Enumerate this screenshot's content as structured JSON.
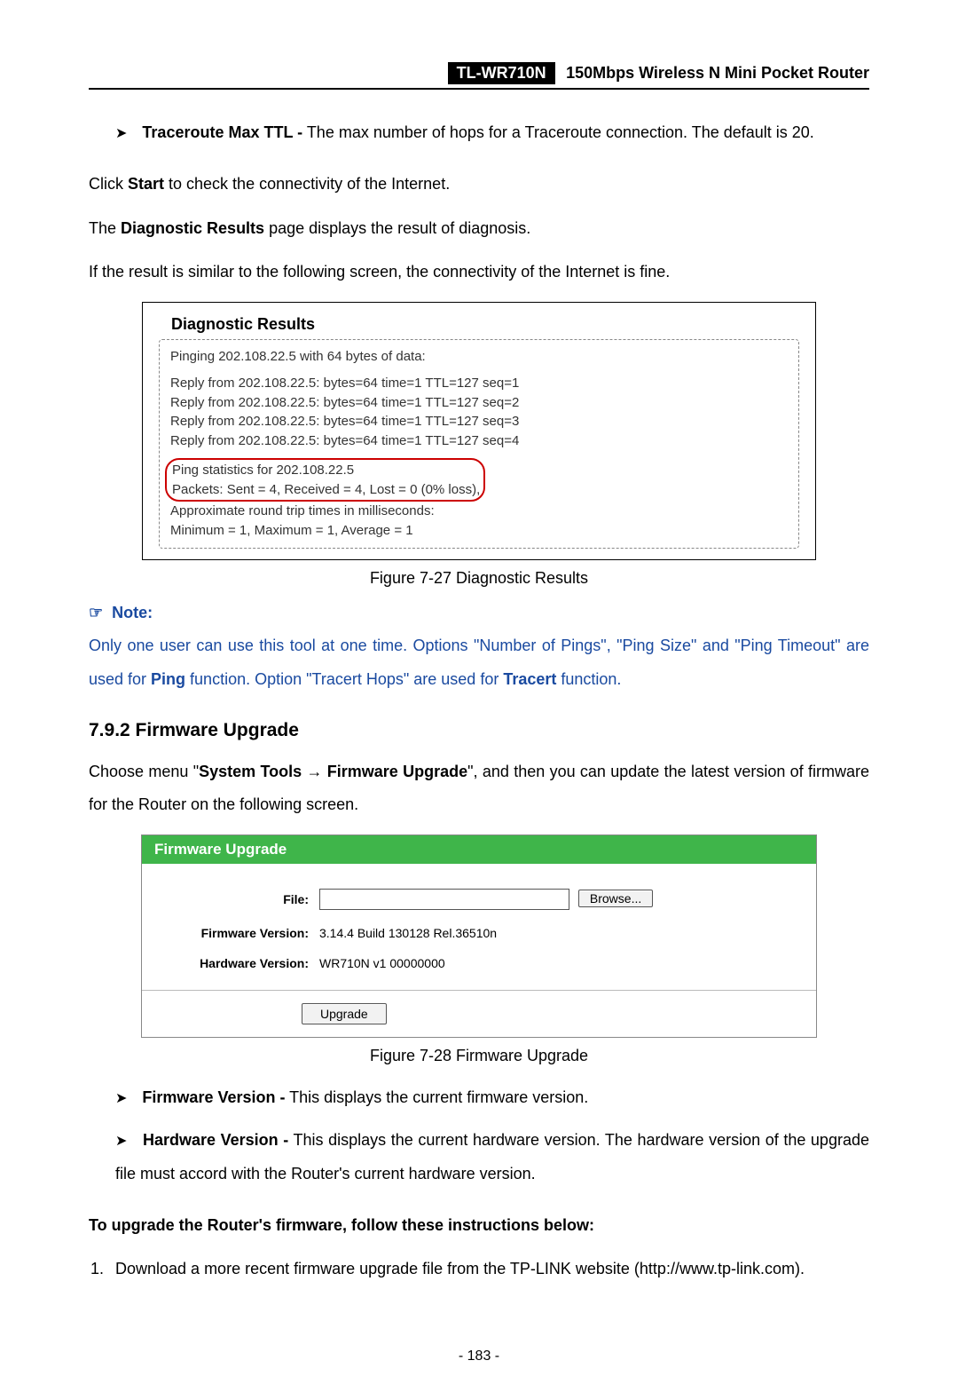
{
  "header": {
    "model": "TL-WR710N",
    "desc": "150Mbps Wireless N Mini Pocket Router"
  },
  "bullet1": {
    "term": "Traceroute Max TTL -",
    "rest": " The max number of hops for a Traceroute connection. The default is 20."
  },
  "p_click_pre": "Click ",
  "p_click_bold": "Start",
  "p_click_post": " to check the connectivity of the Internet.",
  "p_diag_pre": "The ",
  "p_diag_bold": "Diagnostic Results",
  "p_diag_post": " page displays the result of diagnosis.",
  "p_if": "If the result is similar to the following screen, the connectivity of the Internet is fine.",
  "diag": {
    "title": "Diagnostic Results",
    "ping_hdr": "Pinging 202.108.22.5 with 64 bytes of data:",
    "r1": "Reply from 202.108.22.5:  bytes=64  time=1  TTL=127  seq=1",
    "r2": "Reply from 202.108.22.5:  bytes=64  time=1  TTL=127  seq=2",
    "r3": "Reply from 202.108.22.5:  bytes=64  time=1  TTL=127  seq=3",
    "r4": "Reply from 202.108.22.5:  bytes=64  time=1  TTL=127  seq=4",
    "stat1": "Ping statistics for 202.108.22.5",
    "stat2": "  Packets: Sent = 4, Received = 4, Lost = 0 (0% loss),",
    "rtt1": "Approximate round trip times in milliseconds:",
    "rtt2": "  Minimum = 1, Maximum = 1, Average = 1"
  },
  "fig27": "Figure 7-27    Diagnostic Results",
  "note": {
    "label": "Note:",
    "body_pre": "Only one user can use this tool at one time. Options \"Number of Pings\", \"Ping Size\" and \"Ping Timeout\" are used for ",
    "bold1": "Ping",
    "mid": " function. Option \"Tracert Hops\" are used for ",
    "bold2": "Tracert",
    "post": " function."
  },
  "sec": "7.9.2  Firmware Upgrade",
  "para_fw_pre": "Choose menu \"",
  "para_fw_b1": "System Tools",
  "para_fw_arrow": " → ",
  "para_fw_b2": "Firmware Upgrade",
  "para_fw_post": "\", and then you can update the latest version of firmware for the Router on the following screen.",
  "fw": {
    "hdr": "Firmware Upgrade",
    "file_lbl": "File:",
    "browse": "Browse...",
    "fwver_lbl": "Firmware Version:",
    "fwver_val": "3.14.4 Build 130128 Rel.36510n",
    "hwver_lbl": "Hardware Version:",
    "hwver_val": "WR710N v1 00000000",
    "upgrade": "Upgrade"
  },
  "fig28": "Figure 7-28    Firmware Upgrade",
  "bullet_fw": {
    "term": "Firmware Version -",
    "rest": " This displays the current firmware version."
  },
  "bullet_hw": {
    "term": "Hardware Version -",
    "rest": " This displays the current hardware version. The hardware version of the upgrade file must accord with the Router's current hardware version."
  },
  "upgrade_instr": "To upgrade the Router's firmware, follow these instructions below:",
  "ol1": "Download a more recent firmware upgrade file from the TP-LINK website (http://www.tp-link.com).",
  "page_num": "- 183 -"
}
